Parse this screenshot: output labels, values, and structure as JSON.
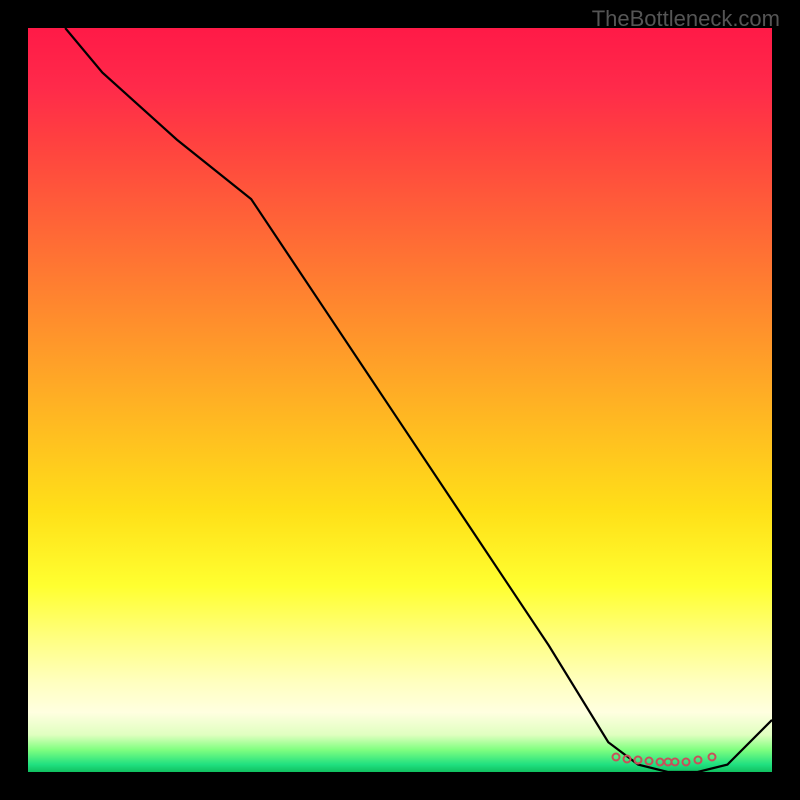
{
  "watermark": "TheBottleneck.com",
  "chart_data": {
    "type": "line",
    "title": "",
    "xlabel": "",
    "ylabel": "",
    "xlim": [
      0,
      100
    ],
    "ylim": [
      0,
      100
    ],
    "series": [
      {
        "name": "curve",
        "x": [
          5,
          10,
          20,
          30,
          40,
          50,
          60,
          70,
          78,
          82,
          86,
          90,
          94,
          100
        ],
        "y": [
          100,
          94,
          85,
          77,
          62,
          47,
          32,
          17,
          4,
          1,
          0,
          0,
          1,
          7
        ]
      }
    ],
    "markers": {
      "x": [
        79,
        80.5,
        82,
        83.5,
        85,
        86,
        87,
        88.5,
        90,
        92
      ],
      "y": [
        2,
        1.8,
        1.6,
        1.5,
        1.4,
        1.3,
        1.3,
        1.4,
        1.6,
        2
      ]
    }
  }
}
